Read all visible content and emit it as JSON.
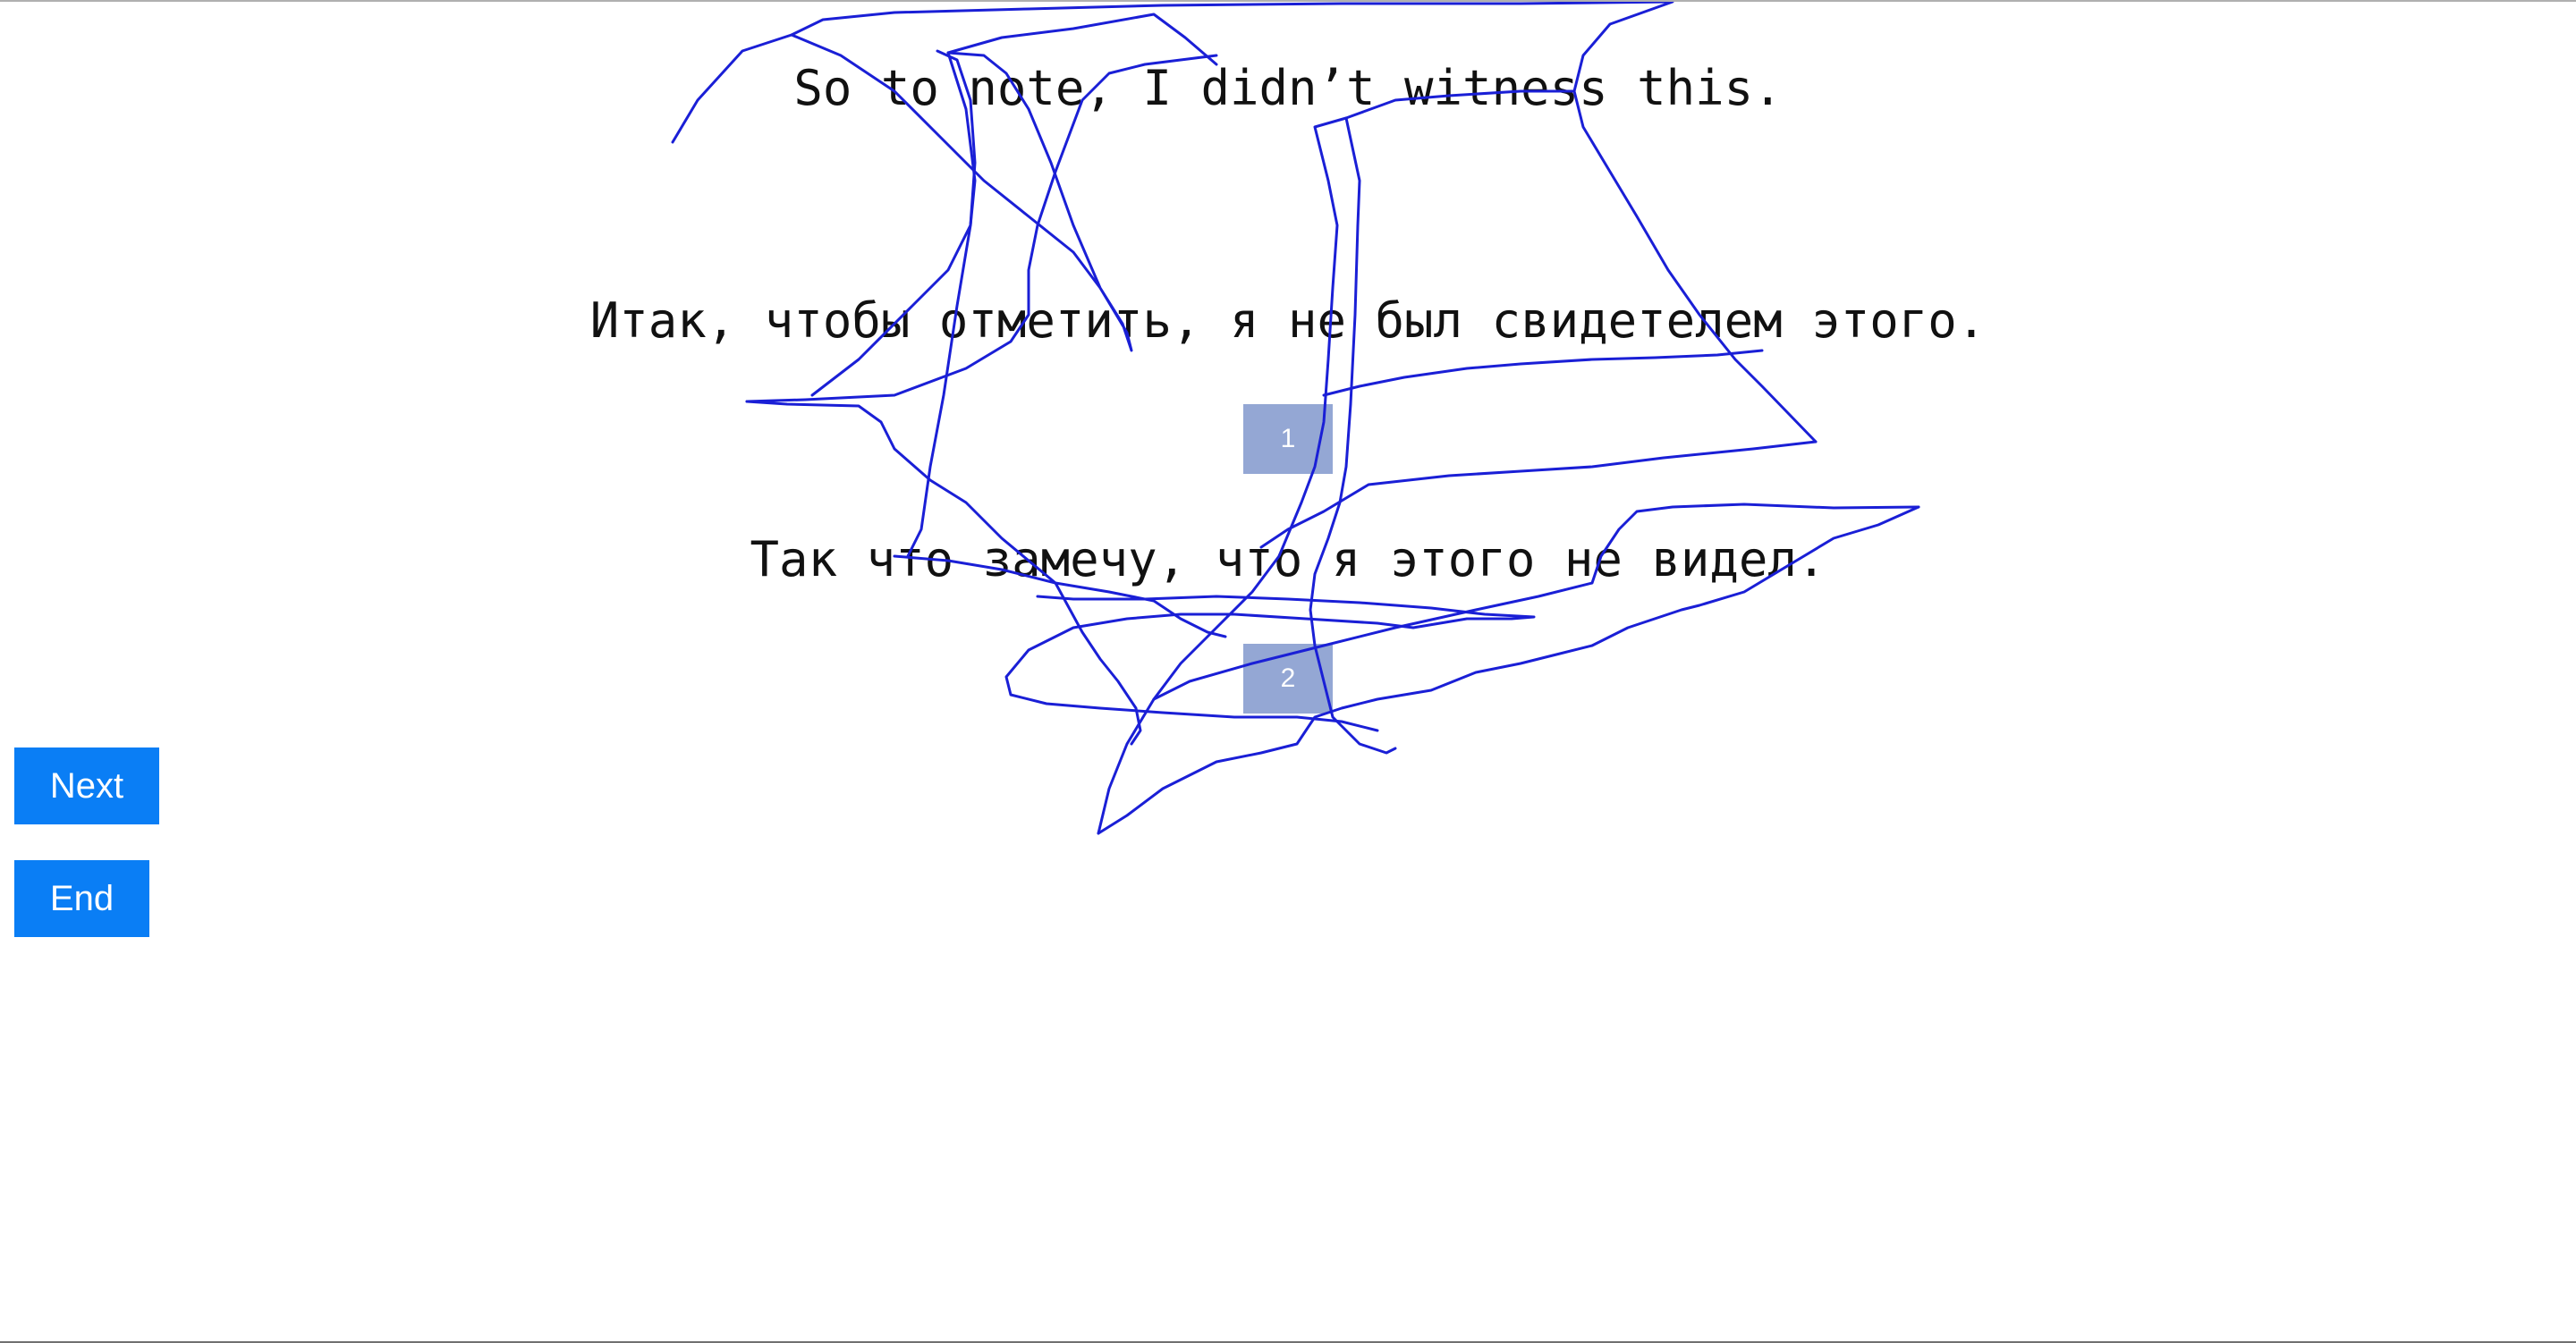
{
  "sentences": {
    "source": "So to note, I didn’t witness this.",
    "candidate_1": "Итак, чтобы отметить, я не был свидетелем этого.",
    "candidate_2": "Так что замечу, что я этого не видел."
  },
  "choices": {
    "option_1": "1",
    "option_2": "2"
  },
  "controls": {
    "next_label": "Next",
    "end_label": "End"
  },
  "colors": {
    "button_blue": "#0a7ef5",
    "choice_box": "#94a7d4",
    "scribble_stroke": "#1a1fd6"
  }
}
